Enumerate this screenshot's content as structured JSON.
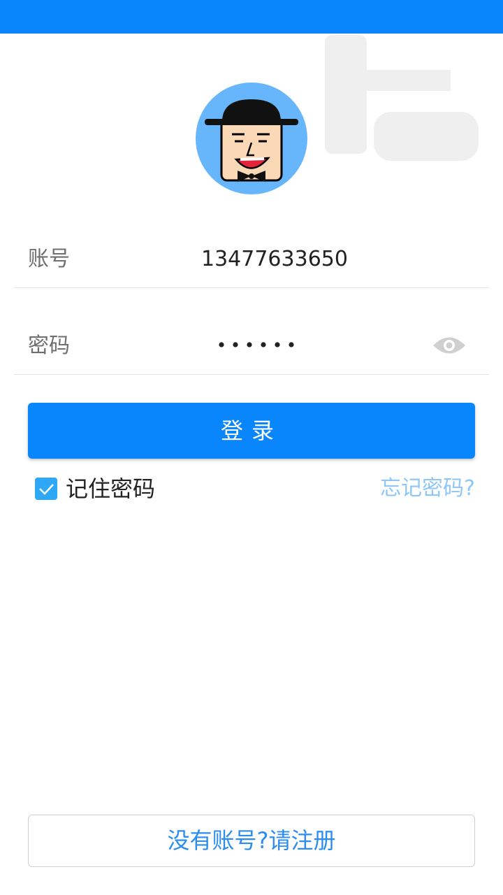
{
  "status_bar": {
    "color": "#0a86fd"
  },
  "avatar": {
    "icon": "cartoon-man-with-bowler-hat",
    "background": "#67b6fb"
  },
  "account": {
    "label": "账号",
    "value": "13477633650"
  },
  "password": {
    "label": "密码",
    "masked_value": "••••••",
    "visibility_icon": "eye-icon"
  },
  "login": {
    "label": "登录"
  },
  "remember": {
    "label": "记住密码",
    "checked": true
  },
  "forgot": {
    "label": "忘记密码?"
  },
  "register": {
    "label": "没有账号?请注册"
  },
  "colors": {
    "primary": "#0a86fd",
    "link": "#2c8df0",
    "muted_link": "#8ec6f7"
  }
}
